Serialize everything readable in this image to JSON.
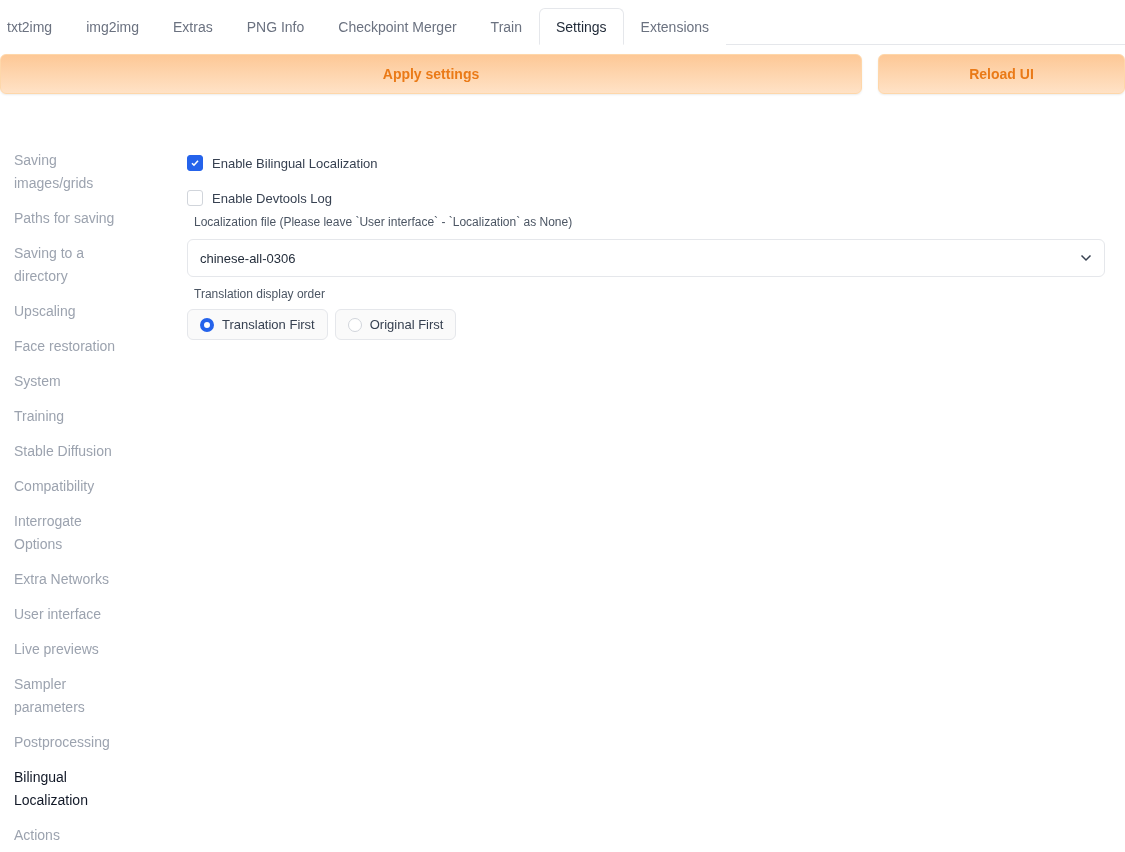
{
  "tabs": [
    {
      "label": "txt2img",
      "selected": false
    },
    {
      "label": "img2img",
      "selected": false
    },
    {
      "label": "Extras",
      "selected": false
    },
    {
      "label": "PNG Info",
      "selected": false
    },
    {
      "label": "Checkpoint Merger",
      "selected": false
    },
    {
      "label": "Train",
      "selected": false
    },
    {
      "label": "Settings",
      "selected": true
    },
    {
      "label": "Extensions",
      "selected": false
    }
  ],
  "buttons": [
    {
      "label": "Apply settings"
    },
    {
      "label": "Reload UI"
    }
  ],
  "sidebar": {
    "items": [
      {
        "label": "Saving images/grids",
        "selected": false
      },
      {
        "label": "Paths for saving",
        "selected": false
      },
      {
        "label": "Saving to a directory",
        "selected": false
      },
      {
        "label": "Upscaling",
        "selected": false
      },
      {
        "label": "Face restoration",
        "selected": false
      },
      {
        "label": "System",
        "selected": false
      },
      {
        "label": "Training",
        "selected": false
      },
      {
        "label": "Stable Diffusion",
        "selected": false
      },
      {
        "label": "Compatibility",
        "selected": false
      },
      {
        "label": "Interrogate Options",
        "selected": false
      },
      {
        "label": "Extra Networks",
        "selected": false
      },
      {
        "label": "User interface",
        "selected": false
      },
      {
        "label": "Live previews",
        "selected": false
      },
      {
        "label": "Sampler parameters",
        "selected": false
      },
      {
        "label": "Postprocessing",
        "selected": false
      },
      {
        "label": "Bilingual Localization",
        "selected": true
      },
      {
        "label": "Actions",
        "selected": false
      }
    ]
  },
  "settings": {
    "checkboxes": [
      {
        "label": "Enable Bilingual Localization",
        "checked": true
      },
      {
        "label": "Enable Devtools Log",
        "checked": false
      }
    ],
    "localization_file": {
      "label": "Localization file (Please leave `User interface` - `Localization` as None)",
      "value": "chinese-all-0306"
    },
    "display_order": {
      "label": "Translation display order",
      "options": [
        {
          "label": "Translation First",
          "selected": true
        },
        {
          "label": "Original First",
          "selected": false
        }
      ]
    }
  }
}
